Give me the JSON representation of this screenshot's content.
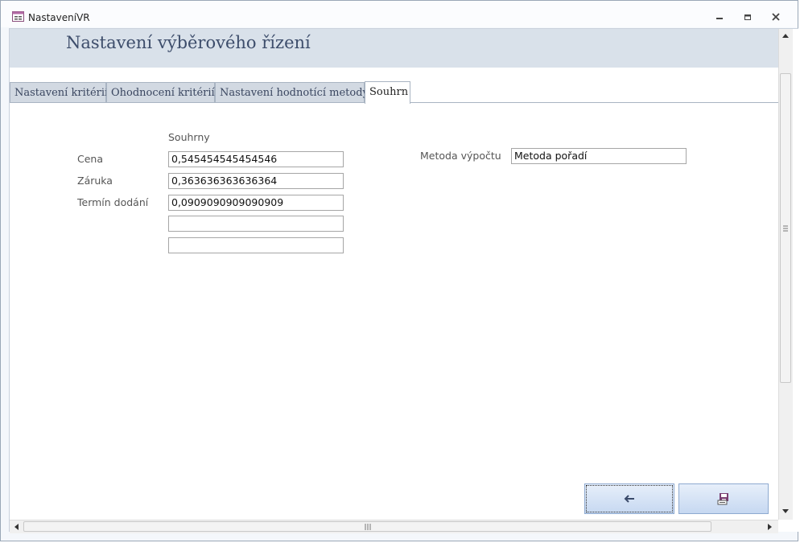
{
  "window": {
    "title": "NastaveníVR"
  },
  "form": {
    "title": "Nastavení výběrového řízení"
  },
  "tabs": [
    {
      "label": "Nastavení kritérií"
    },
    {
      "label": "Ohodnocení kritérií"
    },
    {
      "label": "Nastavení hodnotící metody"
    },
    {
      "label": "Souhrn"
    }
  ],
  "summary": {
    "header": "Souhrny",
    "rows": [
      {
        "label": "Cena",
        "value": "0,545454545454546"
      },
      {
        "label": "Záruka",
        "value": "0,363636363636364"
      },
      {
        "label": "Termín dodání",
        "value": "0,0909090909090909"
      },
      {
        "label": "",
        "value": ""
      },
      {
        "label": "",
        "value": ""
      }
    ]
  },
  "method": {
    "label": "Metoda výpočtu",
    "value": "Metoda pořadí"
  },
  "buttons": {
    "back_icon": "arrow-left-icon",
    "save_icon": "save-icon"
  },
  "colors": {
    "accent": "#3d4d6b",
    "header_band": "#d9e1ea",
    "button_blue": "#c6d8f1"
  }
}
